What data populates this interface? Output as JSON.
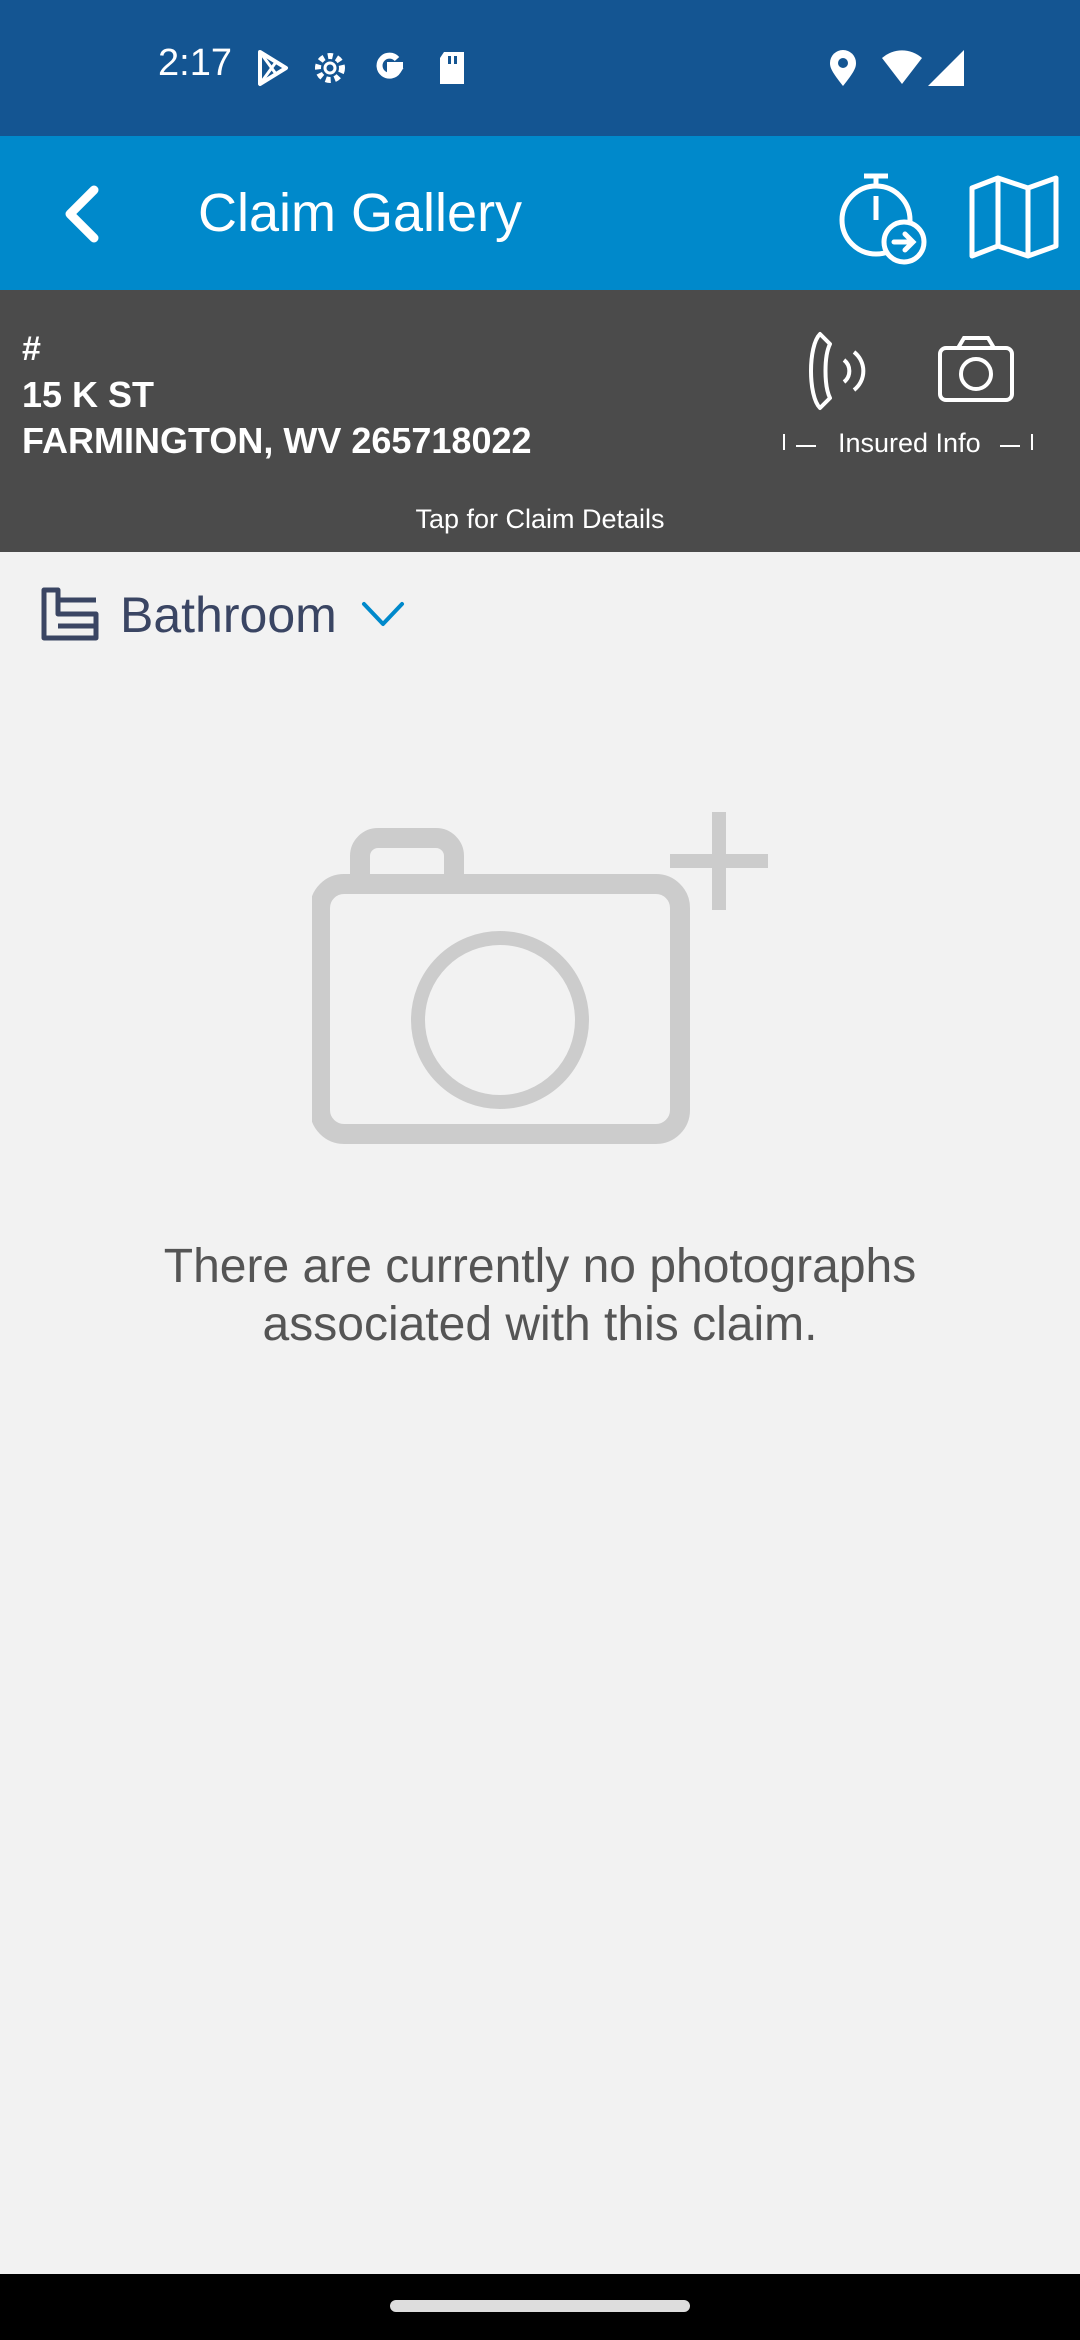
{
  "status_bar": {
    "time": "2:17",
    "left_icons": [
      "play-store-icon",
      "settings-icon",
      "google-icon",
      "sd-card-icon"
    ],
    "right_icons": [
      "location-icon",
      "wifi-icon",
      "signal-icon"
    ]
  },
  "app_bar": {
    "title": "Claim Gallery",
    "back_icon": "chevron-left-icon",
    "actions": [
      "timer-icon",
      "map-icon"
    ]
  },
  "claim": {
    "number": "#",
    "address_line1": "15 K ST",
    "address_line2": "FARMINGTON, WV 265718022",
    "insured_info_label": "Insured Info",
    "tap_hint": "Tap for Claim Details"
  },
  "room": {
    "selected": "Bathroom"
  },
  "empty_state": {
    "message": "There are currently no photographs associated with this claim."
  },
  "colors": {
    "status_bar": "#145592",
    "app_bar": "#0089cb",
    "claim_header": "#4b4b4b",
    "background": "#f2f2f2",
    "accent": "#0089cb"
  }
}
